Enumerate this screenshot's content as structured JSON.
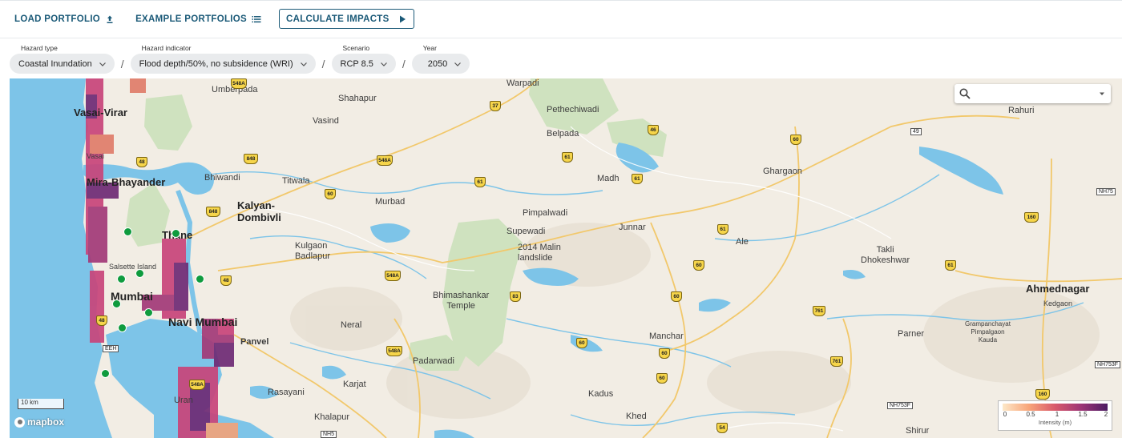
{
  "toolbar": {
    "load_label": "LOAD PORTFOLIO",
    "example_label": "EXAMPLE PORTFOLIOS",
    "calculate_label": "CALCULATE IMPACTS",
    "icons": [
      "upload-icon",
      "list-icon",
      "play-icon"
    ]
  },
  "filters": {
    "hazard_type": {
      "label": "Hazard type",
      "value": "Coastal Inundation"
    },
    "hazard_indicator": {
      "label": "Hazard indicator",
      "value": "Flood depth/50%, no subsidence (WRI)"
    },
    "scenario": {
      "label": "Scenario",
      "value": "RCP 8.5"
    },
    "year": {
      "label": "Year",
      "value": "2050"
    },
    "separator": "/"
  },
  "map": {
    "search": {
      "placeholder": "",
      "icon": "search-icon"
    },
    "scale_label": "10 km",
    "attribution": "mapbox",
    "legend": {
      "title": "Intensity (m)",
      "ticks": [
        "0",
        "0.5",
        "1",
        "1.5",
        "2"
      ]
    },
    "labels": {
      "vasai_virar": "Vasai-Virar",
      "vasai": "Vasai",
      "mira": "Mira-Bhayander",
      "thane": "Thane",
      "salsette": "Salsette Island",
      "mumbai": "Mumbai",
      "navi_mumbai": "Navi Mumbai",
      "panvel": "Panvel",
      "uran": "Uran",
      "eeh": "EEH",
      "umberpada": "Umberpada",
      "shahapur": "Shahapur",
      "vasind": "Vasind",
      "bhiwandi": "Bhiwandi",
      "titwala": "Titwala",
      "kalyan": "Kalyan-\nDombivli",
      "murbad": "Murbad",
      "kulgaon": "Kulgaon\nBadlapur",
      "neral": "Neral",
      "karjat": "Karjat",
      "rasayani": "Rasayani",
      "khalapur": "Khalapur",
      "warpadi": "Warpadi",
      "pethechiwadi": "Pethechiwadi",
      "belpada": "Belpada",
      "madh": "Madh",
      "pimpalwadi": "Pimpalwadi",
      "supewadi": "Supewadi",
      "malin": "2014 Malin\nlandslide",
      "bhimashankar": "Bhimashankar\nTemple",
      "padarwadi": "Padarwadi",
      "junnar": "Junnar",
      "ghargaon": "Ghargaon",
      "ale": "Ale",
      "takli": "Takli\nDhokeshwar",
      "manchar": "Manchar",
      "kadus": "Kadus",
      "khed": "Khed",
      "parner": "Parner",
      "rahuri": "Rahuri",
      "ahmednagar": "Ahmednagar",
      "kedgaon": "Kedgaon",
      "grampanchayat": "Grampanchayat\nPimpalgaon\nKauda",
      "shirur": "Shirur"
    },
    "shields": [
      "37",
      "46",
      "48",
      "848",
      "548A",
      "61",
      "61",
      "61",
      "60",
      "848",
      "49",
      "60",
      "61",
      "160",
      "48",
      "548A",
      "60",
      "83",
      "60",
      "761",
      "61",
      "60",
      "548A",
      "60",
      "761",
      "60",
      "48",
      "548A",
      "548A",
      "160",
      "54"
    ],
    "nh_labels": [
      "NH753F",
      "NH753F",
      "NH75",
      "NH5"
    ]
  },
  "colors": {
    "accent": "#1b5a78",
    "water": "#7dc4e8",
    "land": "#f2ede4",
    "park": "#cfe2bf",
    "asset": "#0f9b3e"
  }
}
